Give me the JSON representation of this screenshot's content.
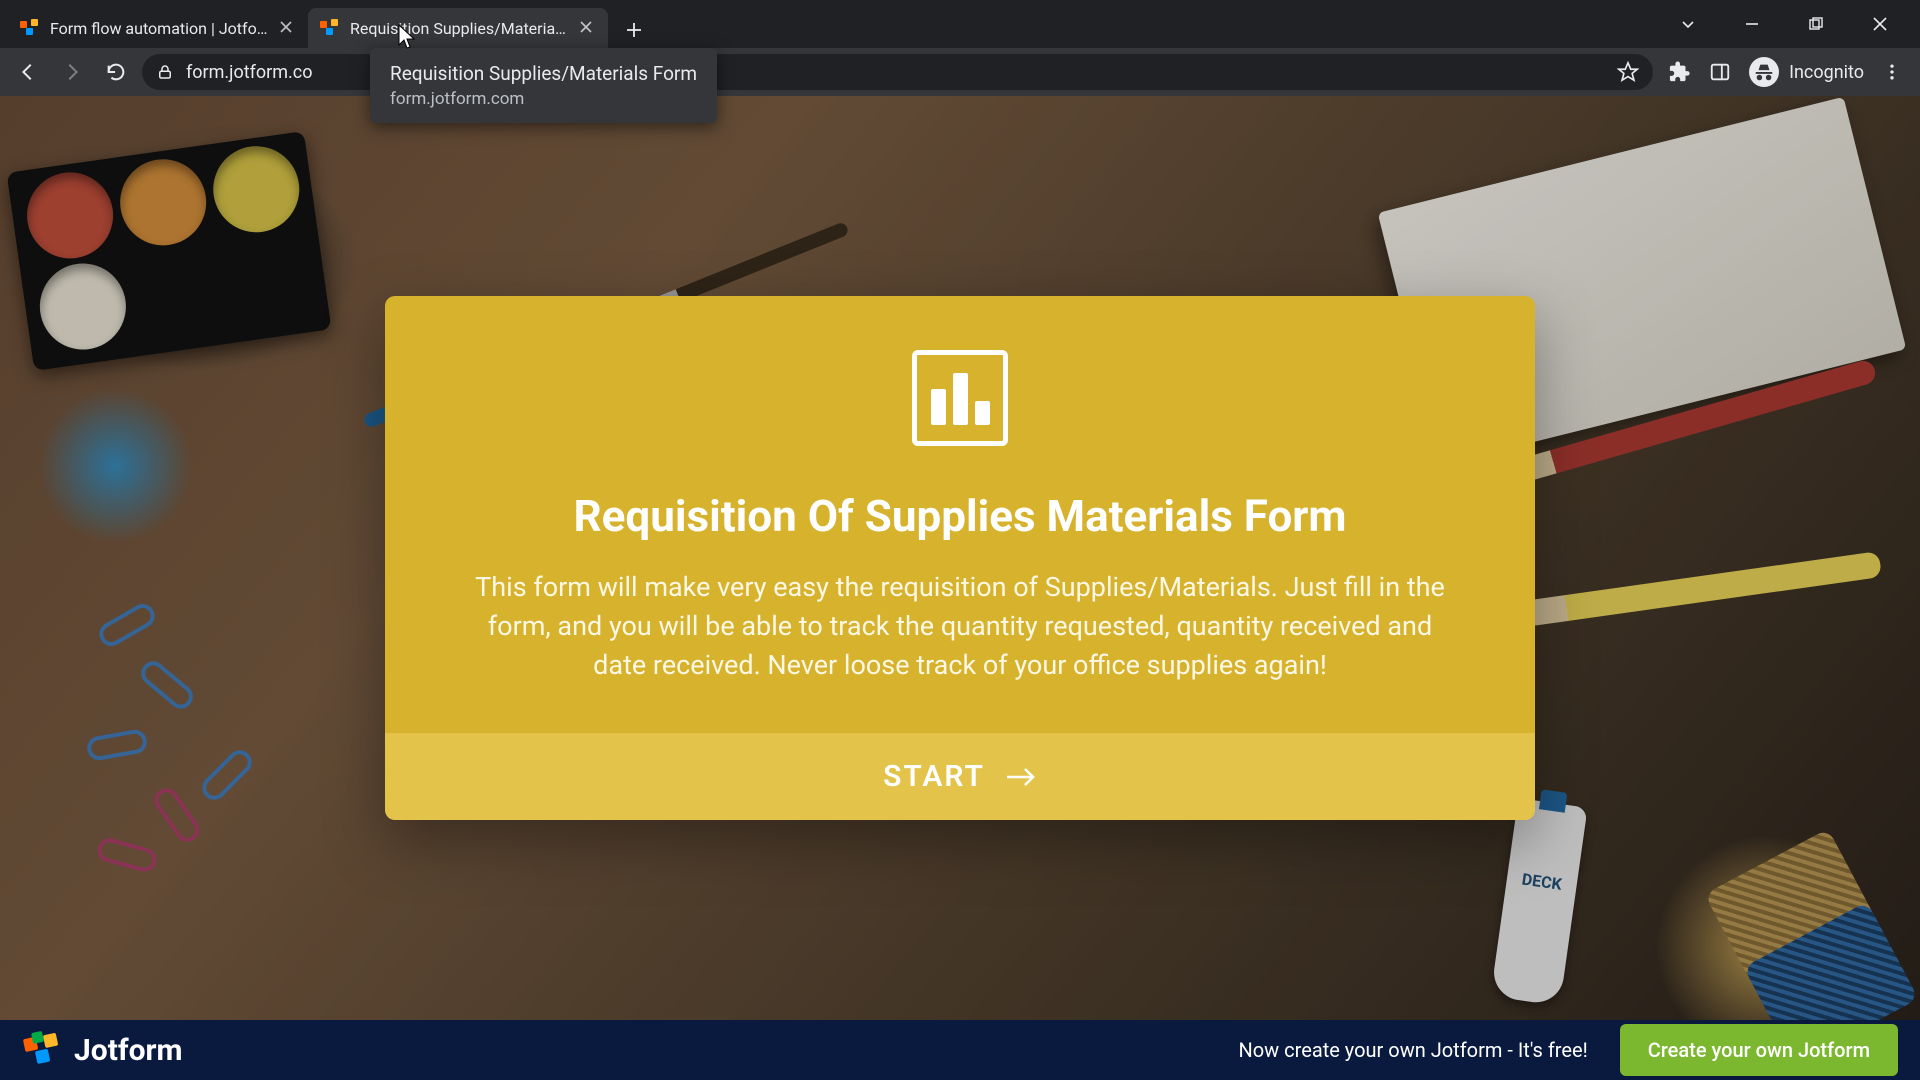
{
  "browser": {
    "tabs": [
      {
        "title": "Form flow automation | Jotform",
        "active": false
      },
      {
        "title": "Requisition Supplies/Materials Fo",
        "active": true
      }
    ],
    "tooltip": {
      "title": "Requisition Supplies/Materials Form",
      "url": "form.jotform.com"
    },
    "url_display": "form.jotform.co",
    "incognito_label": "Incognito"
  },
  "form": {
    "title": "Requisition Of Supplies Materials Form",
    "description": "This form will make very easy the requisition of Supplies/Materials. Just fill in the form, and you will be able to track the quantity requested, quantity received and date received. Never loose track of your office supplies again!",
    "start_label": "START"
  },
  "footer": {
    "brand": "Jotform",
    "message": "Now create your own Jotform - It's free!",
    "cta": "Create your own Jotform"
  },
  "colors": {
    "card": "#d6b22d",
    "card_btn": "#e3c34a",
    "footer": "#0a1a3f",
    "cta": "#7bb82f"
  }
}
